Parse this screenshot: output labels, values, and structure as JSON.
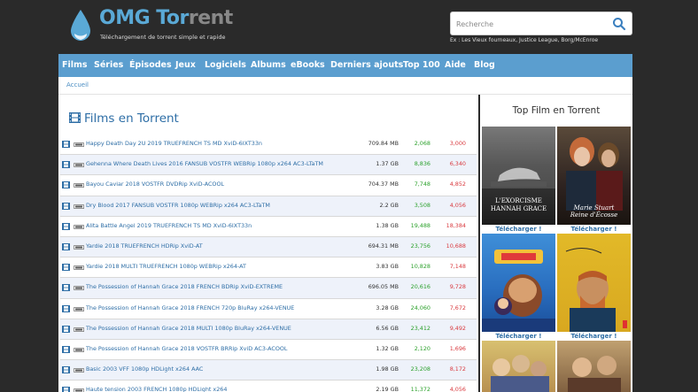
{
  "header": {
    "logo_main": "OMG Tor",
    "logo_dim": "rent",
    "tagline": "Téléchargement de torrent simple et rapide",
    "search_placeholder": "Recherche",
    "search_hint": "Ex : Les Vieux fourneaux, Justice League, Borg/McEnroe"
  },
  "nav": {
    "items": [
      "Films",
      "Séries",
      "Épisodes",
      "Jeux",
      "Logiciels",
      "Albums",
      "eBooks",
      "Derniers ajouts",
      "Top 100",
      "Aide",
      "Blog"
    ]
  },
  "breadcrumb": {
    "home": "Accueil"
  },
  "main": {
    "title": "Films en Torrent",
    "rows": [
      {
        "name": "Happy Death Day 2U 2019 TRUEFRENCH TS MD XviD-6IXT33n",
        "size": "709.84 MB",
        "seeders": "2,068",
        "leechers": "3,000"
      },
      {
        "name": "Gehenna Where Death Lives 2016 FANSUB VOSTFR WEBRip 1080p x264 AC3-LTaTM",
        "size": "1.37 GB",
        "seeders": "8,836",
        "leechers": "6,340"
      },
      {
        "name": "Bayou Caviar 2018 VOSTFR DVDRip XviD-ACOOL",
        "size": "704.37 MB",
        "seeders": "7,748",
        "leechers": "4,852"
      },
      {
        "name": "Dry Blood 2017 FANSUB VOSTFR 1080p WEBRip x264 AC3-LTaTM",
        "size": "2.2 GB",
        "seeders": "3,508",
        "leechers": "4,056"
      },
      {
        "name": "Alita Battle Angel 2019 TRUEFRENCH TS MD XviD-6IXT33n",
        "size": "1.38 GB",
        "seeders": "19,488",
        "leechers": "18,384"
      },
      {
        "name": "Yardie 2018 TRUEFRENCH HDRip XviD-AT",
        "size": "694.31 MB",
        "seeders": "23,756",
        "leechers": "10,688"
      },
      {
        "name": "Yardie 2018 MULTI TRUEFRENCH 1080p WEBRip x264-AT",
        "size": "3.83 GB",
        "seeders": "10,828",
        "leechers": "7,148"
      },
      {
        "name": "The Possession of Hannah Grace 2018 FRENCH BDRip XviD-EXTREME",
        "size": "696.05 MB",
        "seeders": "20,616",
        "leechers": "9,728"
      },
      {
        "name": "The Possession of Hannah Grace 2018 FRENCH 720p BluRay x264-VENUE",
        "size": "3.28 GB",
        "seeders": "24,060",
        "leechers": "7,672"
      },
      {
        "name": "The Possession of Hannah Grace 2018 MULTI 1080p BluRay x264-VENUE",
        "size": "6.56 GB",
        "seeders": "23,412",
        "leechers": "9,492"
      },
      {
        "name": "The Possession of Hannah Grace 2018 VOSTFR BRRip XviD AC3-ACOOL",
        "size": "1.32 GB",
        "seeders": "2,120",
        "leechers": "1,696"
      },
      {
        "name": "Basic 2003 VFF 1080p HDLight x264 AAC",
        "size": "1.98 GB",
        "seeders": "23,208",
        "leechers": "8,172"
      },
      {
        "name": "Haute tension 2003 FRENCH 1080p HDLight x264",
        "size": "2.19 GB",
        "seeders": "11,372",
        "leechers": "4,056"
      }
    ]
  },
  "sidebar": {
    "title": "Top Film en Torrent",
    "download_label": "Télécharger !",
    "poster_texts": [
      "L'EXORCISME\nHANNAH GRACE",
      "Marie Stuart\nReine d'Écosse",
      "",
      ""
    ]
  },
  "colors": {
    "accent": "#5b9ecf",
    "link": "#2e6ea6",
    "seed": "#2aa02a",
    "leech": "#d9393e",
    "background": "#2a2a2a"
  }
}
